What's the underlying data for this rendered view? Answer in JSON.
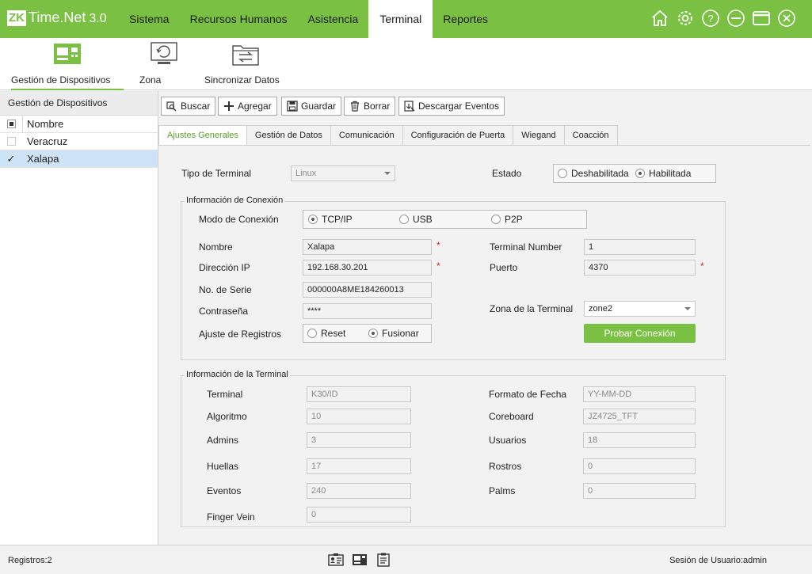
{
  "app": {
    "logo_badge": "ZK",
    "logo_name": "Time.Net",
    "logo_version": "3.0"
  },
  "menu": [
    "Sistema",
    "Recursos Humanos",
    "Asistencia",
    "Terminal",
    "Reportes"
  ],
  "menu_active": "Terminal",
  "window_icons": [
    "home-icon",
    "gear-icon",
    "help-icon",
    "minimize-icon",
    "maximize-icon",
    "close-icon"
  ],
  "subtoolbar": {
    "items": [
      {
        "label": "Gestión de Dispositivos",
        "icon": "device-management-icon",
        "active": true
      },
      {
        "label": "Zona",
        "icon": "zone-icon",
        "active": false
      },
      {
        "label": "Sincronizar Datos",
        "icon": "sync-data-icon",
        "active": false
      }
    ]
  },
  "sidebar": {
    "title": "Gestión de Dispositivos",
    "column_header": "Nombre",
    "rows": [
      {
        "name": "Veracruz",
        "checked": false,
        "selected": false
      },
      {
        "name": "Xalapa",
        "checked": true,
        "selected": true
      }
    ]
  },
  "actions": {
    "search": "Buscar",
    "add": "Agregar",
    "save": "Guardar",
    "delete": "Borrar",
    "download": "Descargar Eventos"
  },
  "tabs": [
    "Ajustes Generales",
    "Gestión de Datos",
    "Comunicación",
    "Configuración de Puerta",
    "Wiegand",
    "Coacción"
  ],
  "tab_active": "Ajustes Generales",
  "general": {
    "terminal_type_label": "Tipo de Terminal",
    "terminal_type_value": "Linux",
    "status_label": "Estado",
    "status_options": [
      "Deshabilitada",
      "Habilitada"
    ],
    "status_selected": "Habilitada"
  },
  "connection": {
    "title": "Información de Conexión",
    "mode_label": "Modo de Conexión",
    "mode_options": [
      "TCP/IP",
      "USB",
      "P2P"
    ],
    "mode_selected": "TCP/IP",
    "name_label": "Nombre",
    "name_value": "Xalapa",
    "ip_label": "Dirección IP",
    "ip_value": "192.168.30.201",
    "serial_label": "No. de Serie",
    "serial_value": "000000A8ME184260013",
    "password_label": "Contraseña",
    "password_value": "****",
    "records_label": "Ajuste de Registros",
    "records_options": [
      "Reset",
      "Fusionar"
    ],
    "records_selected": "Fusionar",
    "terminal_number_label": "Terminal Number",
    "terminal_number_value": "1",
    "port_label": "Puerto",
    "port_value": "4370",
    "zone_label": "Zona de la Terminal",
    "zone_value": "zone2",
    "test_button": "Probar Conexión",
    "required_mark": "*"
  },
  "terminal_info": {
    "title": "Información de la Terminal",
    "terminal_label": "Terminal",
    "terminal_value": "K30/ID",
    "algorithm_label": "Algoritmo",
    "algorithm_value": "10",
    "admins_label": "Admins",
    "admins_value": "3",
    "fingerprints_label": "Huellas",
    "fingerprints_value": "17",
    "events_label": "Eventos",
    "events_value": "240",
    "fingervein_label": "Finger Vein",
    "fingervein_value": "0",
    "date_format_label": "Formato de Fecha",
    "date_format_value": "YY-MM-DD",
    "coreboard_label": "Coreboard",
    "coreboard_value": "JZ4725_TFT",
    "users_label": "Usuarios",
    "users_value": "18",
    "faces_label": "Rostros",
    "faces_value": "0",
    "palms_label": "Palms",
    "palms_value": "0"
  },
  "statusbar": {
    "records": "Registros:2",
    "session": "Sesión de Usuario:admin",
    "icons": [
      "user-card-icon",
      "terminal-icon",
      "report-icon"
    ]
  },
  "colors": {
    "brand": "#7ac143",
    "selected_row": "#cfe3f7",
    "required": "#d9291c"
  }
}
